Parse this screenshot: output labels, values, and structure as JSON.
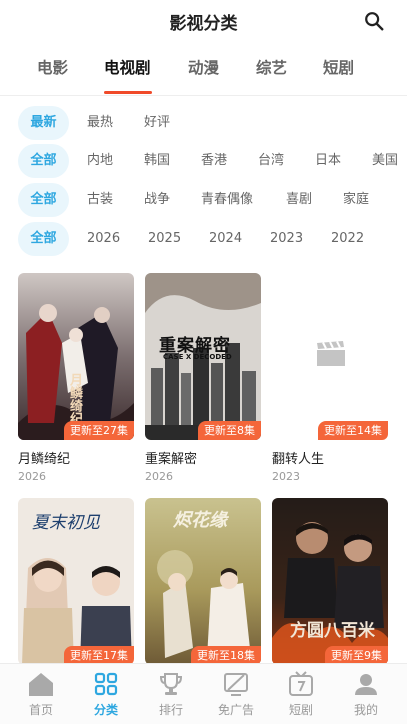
{
  "header": {
    "title": "影视分类"
  },
  "tabs": [
    {
      "label": "电影"
    },
    {
      "label": "电视剧"
    },
    {
      "label": "动漫"
    },
    {
      "label": "综艺"
    },
    {
      "label": "短剧"
    }
  ],
  "active_tab": "电视剧",
  "filters": {
    "sort": [
      "最新",
      "最热",
      "好评"
    ],
    "region": [
      "全部",
      "内地",
      "韩国",
      "香港",
      "台湾",
      "日本",
      "美国"
    ],
    "genre": [
      "全部",
      "古装",
      "战争",
      "青春偶像",
      "喜剧",
      "家庭"
    ],
    "year": [
      "全部",
      "2026",
      "2025",
      "2024",
      "2023",
      "2022"
    ]
  },
  "selected_filters": {
    "sort": "最新",
    "region": "全部",
    "genre": "全部",
    "year": "全部"
  },
  "shows": [
    {
      "title": "月鳞绮纪",
      "year": "2026",
      "badge": "更新至27集",
      "poster_text": "月鳞绮纪"
    },
    {
      "title": "重案解密",
      "year": "2026",
      "badge": "更新至8集",
      "poster_text": "重案解密",
      "poster_subtext": "CASE X DECODED"
    },
    {
      "title": "翻转人生",
      "year": "2023",
      "badge": "更新至14集"
    },
    {
      "title": "",
      "year": "",
      "badge": "更新至17集",
      "poster_text": "夏末初见"
    },
    {
      "title": "",
      "year": "",
      "badge": "更新至18集",
      "poster_text": "烬花缘"
    },
    {
      "title": "",
      "year": "",
      "badge": "更新至9集",
      "poster_text": "方圆八百米"
    }
  ],
  "bottom_nav": [
    {
      "label": "首页",
      "icon": "home-icon"
    },
    {
      "label": "分类",
      "icon": "category-icon"
    },
    {
      "label": "排行",
      "icon": "trophy-icon"
    },
    {
      "label": "免广告",
      "icon": "no-ads-icon"
    },
    {
      "label": "短剧",
      "icon": "tv-icon"
    },
    {
      "label": "我的",
      "icon": "user-icon"
    }
  ],
  "active_nav": "分类",
  "colors": {
    "accent_blue": "#2ea7e0",
    "chip_bg": "#e9f6fc",
    "tab_underline": "#f04a2a",
    "badge_bg": "#f4663a"
  }
}
